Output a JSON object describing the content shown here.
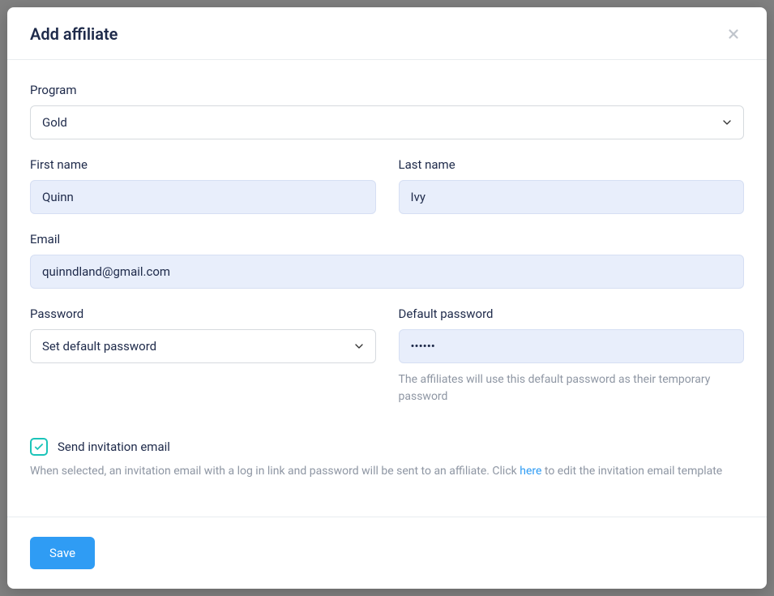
{
  "modal": {
    "title": "Add affiliate"
  },
  "form": {
    "program": {
      "label": "Program",
      "selected": "Gold"
    },
    "first_name": {
      "label": "First name",
      "value": "Quinn"
    },
    "last_name": {
      "label": "Last name",
      "value": "Ivy"
    },
    "email": {
      "label": "Email",
      "value": "quinndland@gmail.com"
    },
    "password": {
      "label": "Password",
      "selected": "Set default password"
    },
    "default_password": {
      "label": "Default password",
      "value": "••••••",
      "help": "The affiliates will use this default password as their temporary password"
    },
    "send_invitation": {
      "label": "Send invitation email",
      "checked": true,
      "description_before": "When selected, an invitation email with a log in link and password will be sent to an affiliate. Click ",
      "link_text": "here",
      "description_after": " to edit the invitation email template"
    }
  },
  "actions": {
    "save": "Save"
  }
}
